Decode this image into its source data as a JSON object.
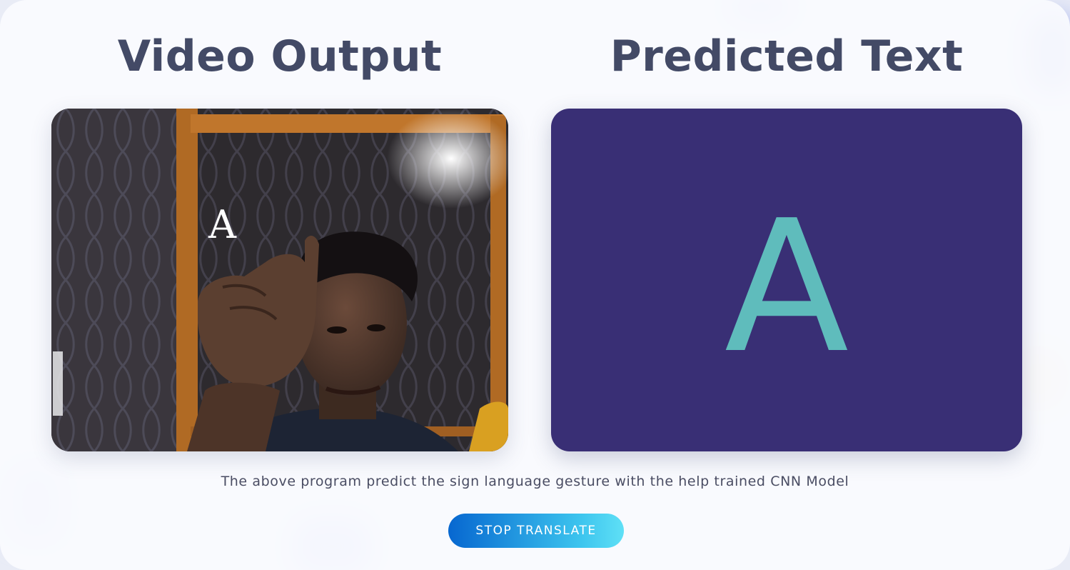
{
  "left_panel": {
    "title": "Video Output",
    "overlay_text": "A"
  },
  "right_panel": {
    "title": "Predicted Text",
    "predicted": "A"
  },
  "caption": "The above program predict the sign language gesture with the help trained CNN Model",
  "buttons": {
    "stop_label": "STOP TRANSLATE"
  },
  "colors": {
    "title": "#434a66",
    "prediction_bg": "#392f75",
    "prediction_letter": "#5fbcbc",
    "button_start": "#0767d0",
    "button_end": "#5fe0f6"
  }
}
